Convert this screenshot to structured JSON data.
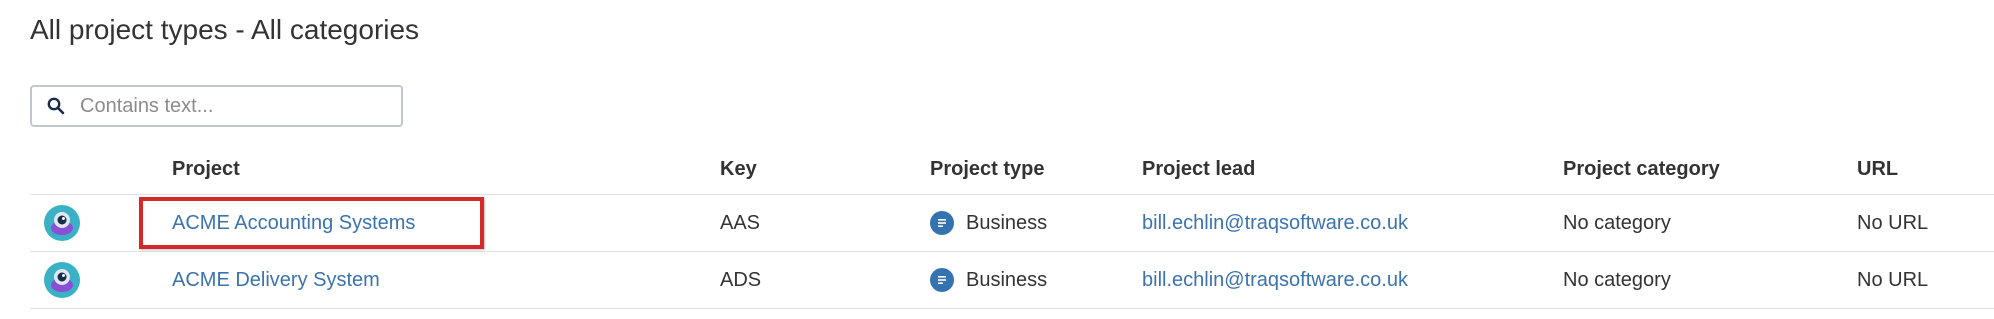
{
  "page": {
    "title": "All project types - All categories"
  },
  "search": {
    "placeholder": "Contains text...",
    "value": ""
  },
  "table": {
    "columns": {
      "avatar": "",
      "project": "Project",
      "key": "Key",
      "type": "Project type",
      "lead": "Project lead",
      "category": "Project category",
      "url": "URL"
    },
    "rows": [
      {
        "avatar_icon": "project-avatar-icon",
        "project": "ACME Accounting Systems",
        "key": "AAS",
        "type_icon": "business-icon",
        "type": "Business",
        "lead": "bill.echlin@traqsoftware.co.uk",
        "category": "No category",
        "url": "No URL"
      },
      {
        "avatar_icon": "project-avatar-icon",
        "project": "ACME Delivery System",
        "key": "ADS",
        "type_icon": "business-icon",
        "type": "Business",
        "lead": "bill.echlin@traqsoftware.co.uk",
        "category": "No category",
        "url": "No URL"
      }
    ]
  },
  "annotation": {
    "highlight_color": "#d62828"
  },
  "colors": {
    "link": "#3b73af",
    "avatar_ring": "#3ab1c4",
    "avatar_body": "#8a4fd4",
    "business_badge": "#3572b0",
    "border": "#dfe1e6"
  }
}
